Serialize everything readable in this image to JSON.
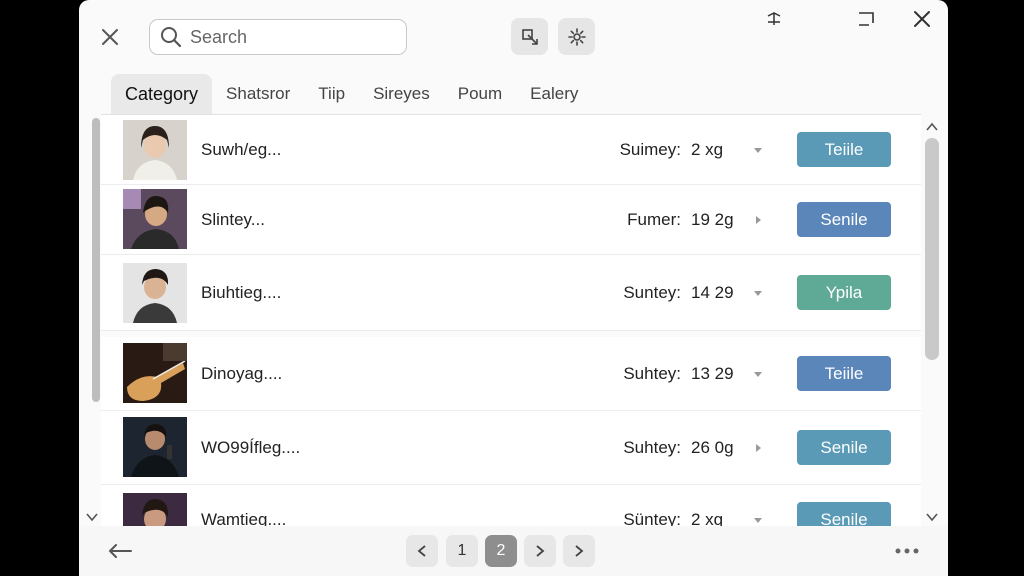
{
  "search": {
    "placeholder": "Search"
  },
  "tabs": [
    {
      "label": "Category",
      "active": true
    },
    {
      "label": "Shatsror"
    },
    {
      "label": "Tiip"
    },
    {
      "label": "Sireyes"
    },
    {
      "label": "Poum"
    },
    {
      "label": "Ealery"
    }
  ],
  "rows": [
    {
      "name": "Suwh/eg...",
      "meta_label": "Suimey:",
      "meta_value": "2 xg",
      "tag": "Teiile",
      "tag_color": "#5a9ab6"
    },
    {
      "name": "Slintey...",
      "meta_label": "Fumer:",
      "meta_value": "19 2g",
      "tag": "Senile",
      "tag_color": "#5b86b9"
    },
    {
      "name": "Biuhtieg....",
      "meta_label": "Suntey:",
      "meta_value": "14 29",
      "tag": "Ypila",
      "tag_color": "#5faa96"
    },
    {
      "name": "Dinoyag....",
      "meta_label": "Suhtey:",
      "meta_value": "13 29",
      "tag": "Teiile",
      "tag_color": "#5b86b9"
    },
    {
      "name": "WO99Ífleg....",
      "meta_label": "Suhtey:",
      "meta_value": "26 0g",
      "tag": "Senile",
      "tag_color": "#5a9ab6"
    },
    {
      "name": "Wamtieg....",
      "meta_label": "Süntey:",
      "meta_value": "2 xg",
      "tag": "Senile",
      "tag_color": "#5a9ab6"
    }
  ],
  "pagination": {
    "page_1": "1",
    "page_current": "2"
  },
  "icons": {
    "close": "close-icon",
    "search": "search-icon",
    "transform": "transform-icon",
    "settings": "gear-icon",
    "back": "arrow-left-icon",
    "more": "more-dots-icon"
  }
}
